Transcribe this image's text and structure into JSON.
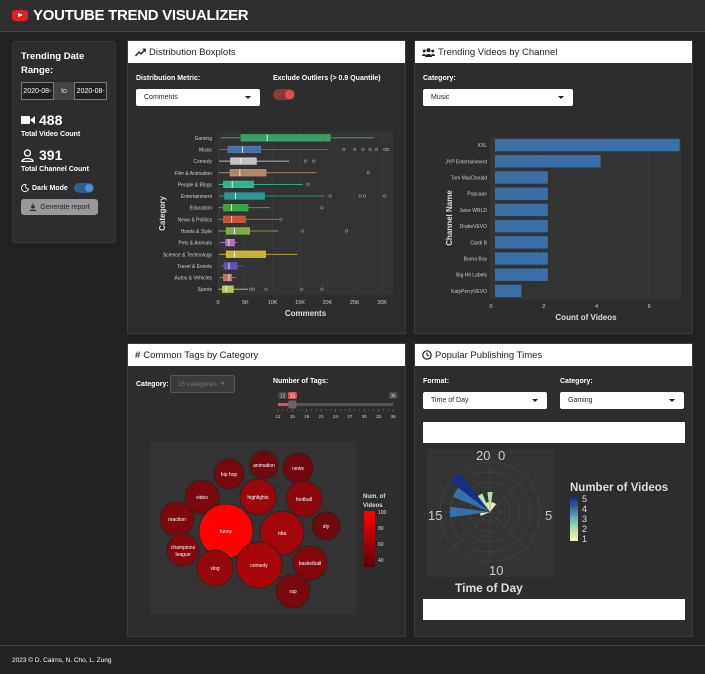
{
  "header": {
    "title": "YOUTUBE TREND VISUALIZER"
  },
  "sidebar": {
    "date_label": "Trending Date Range:",
    "start_date": "2020-08-",
    "to_label": "to",
    "end_date": "2020-08-",
    "video_count": "488",
    "video_count_label": "Total Video Count",
    "channel_count": "391",
    "channel_count_label": "Total Channel Count",
    "dark_mode_label": "Dark Mode",
    "dark_mode_on": true,
    "generate_label": "Generate report"
  },
  "box_card": {
    "title": "Distribution Boxplots",
    "metric_label": "Distribution Metric:",
    "metric_value": "Comments",
    "outlier_label": "Exclude Outliers (> 0.9 Quantile)",
    "outlier_on": true
  },
  "channel_card": {
    "title": "Trending Videos by Channel",
    "category_label": "Category:",
    "category_value": "Music"
  },
  "tags_card": {
    "title": "Common Tags by Category",
    "category_label": "Category:",
    "category_value": "15 categories",
    "num_tags_label": "Number of Tags:",
    "slider_min": "12",
    "slider_max": "36",
    "slider_value": "15",
    "slider_ticks": [
      "12",
      "15",
      "18",
      "21",
      "24",
      "27",
      "30",
      "33",
      "36"
    ]
  },
  "times_card": {
    "title": "Popular Publishing Times",
    "format_label": "Format:",
    "format_value": "Time of Day",
    "category_label": "Category:",
    "category_value": "Gaming"
  },
  "chart_data": [
    {
      "type": "boxplot",
      "title": "",
      "xlabel": "Comments",
      "ylabel": "Category",
      "xlim": [
        0,
        32000
      ],
      "xticks": [
        "0",
        "5K",
        "10K",
        "15K",
        "20K",
        "25K",
        "30K"
      ],
      "categories": [
        "Gaming",
        "Music",
        "Comedy",
        "Film & Animation",
        "People & Blogs",
        "Entertainment",
        "Education",
        "News & Politics",
        "Howto & Style",
        "Pets & Animals",
        "Science & Technology",
        "Travel & Events",
        "Autos & Vehicles",
        "Sports"
      ],
      "colors": [
        "#3cb371",
        "#4a7fb5",
        "#dddddd",
        "#c9956a",
        "#2ecc9a",
        "#2aa8a8",
        "#3bb54a",
        "#e05a40",
        "#8bc34a",
        "#c77dcc",
        "#e8c830",
        "#6a5acd",
        "#d08070",
        "#c8e060"
      ],
      "boxes": [
        {
          "min": 500,
          "q1": 4200,
          "median": 9000,
          "q3": 20500,
          "max": 28500,
          "outliers": []
        },
        {
          "min": 300,
          "q1": 1800,
          "median": 4500,
          "q3": 7800,
          "max": 20000,
          "outliers": [
            23000,
            25000,
            26500,
            27800,
            29000,
            30500,
            31000
          ]
        },
        {
          "min": 200,
          "q1": 2300,
          "median": 4200,
          "q3": 7000,
          "max": 13000,
          "outliers": [
            16000,
            17500
          ]
        },
        {
          "min": 100,
          "q1": 2200,
          "median": 4000,
          "q3": 8800,
          "max": 18000,
          "outliers": [
            27500
          ]
        },
        {
          "min": 100,
          "q1": 1000,
          "median": 2600,
          "q3": 6500,
          "max": 15500,
          "outliers": [
            16500
          ]
        },
        {
          "min": 200,
          "q1": 1200,
          "median": 3200,
          "q3": 8500,
          "max": 19500,
          "outliers": [
            20500,
            26000,
            26800,
            30500
          ]
        },
        {
          "min": 100,
          "q1": 1000,
          "median": 2500,
          "q3": 5500,
          "max": 9500,
          "outliers": [
            19000
          ]
        },
        {
          "min": 100,
          "q1": 1000,
          "median": 2500,
          "q3": 5000,
          "max": 11000,
          "outliers": [
            11500
          ]
        },
        {
          "min": 100,
          "q1": 1500,
          "median": 3000,
          "q3": 5800,
          "max": 11000,
          "outliers": [
            15500,
            23500
          ]
        },
        {
          "min": 400,
          "q1": 1400,
          "median": 2000,
          "q3": 3000,
          "max": 3500,
          "outliers": []
        },
        {
          "min": 200,
          "q1": 1500,
          "median": 3000,
          "q3": 8700,
          "max": 14500,
          "outliers": []
        },
        {
          "min": 500,
          "q1": 1100,
          "median": 2000,
          "q3": 3500,
          "max": 4500,
          "outliers": []
        },
        {
          "min": 300,
          "q1": 1000,
          "median": 2000,
          "q3": 2500,
          "max": 3200,
          "outliers": []
        },
        {
          "min": 100,
          "q1": 800,
          "median": 1500,
          "q3": 2800,
          "max": 5500,
          "outliers": [
            6000,
            6500,
            8800,
            15300,
            19000
          ]
        }
      ]
    },
    {
      "type": "bar",
      "orientation": "horizontal",
      "title": "",
      "xlabel": "Count of Videos",
      "ylabel": "Channel Name",
      "xlim": [
        0,
        7.2
      ],
      "xticks": [
        "0",
        "2",
        "4",
        "6"
      ],
      "categories": [
        "XXL",
        "JYP Entertainment",
        "Tom MacDonald",
        "Popcaan",
        "Juice WRLD",
        "DrakeVEVO",
        "Cardi B",
        "Burna Boy",
        "Big Hit Labels",
        "KatyPerryVEVO"
      ],
      "values": [
        7,
        4,
        2,
        2,
        2,
        2,
        2,
        2,
        2,
        1
      ],
      "color": "#3a6fa8"
    },
    {
      "type": "bubble",
      "title": "",
      "legend_title": "Num. of Videos",
      "legend_ticks": [
        "100",
        "80",
        "60",
        "40"
      ],
      "labels": [
        "hip hop",
        "animation",
        "news",
        "video",
        "highlights",
        "football",
        "reaction",
        "funny",
        "nba",
        "diy",
        "champions league",
        "vlog",
        "comedy",
        "basketball",
        "rap"
      ],
      "values": [
        38,
        36,
        35,
        40,
        55,
        48,
        42,
        100,
        58,
        36,
        45,
        52,
        60,
        44,
        40
      ]
    },
    {
      "type": "polar-bar",
      "title": "",
      "axis_title": "Time of Day",
      "angular_ticks": [
        "0",
        "5",
        "10",
        "15",
        "20"
      ],
      "legend_title": "Number of Videos",
      "legend_ticks": [
        "5",
        "4",
        "3",
        "2",
        "1"
      ],
      "bins": [
        {
          "hour": 20,
          "value": 4
        },
        {
          "hour": 21,
          "value": 5
        },
        {
          "hour": 22,
          "value": 2
        },
        {
          "hour": 23,
          "value": 1
        },
        {
          "hour": 0,
          "value": 2
        },
        {
          "hour": 1,
          "value": 1
        },
        {
          "hour": 2,
          "value": 1
        },
        {
          "hour": 18,
          "value": 4
        },
        {
          "hour": 17,
          "value": 1
        }
      ]
    }
  ]
}
